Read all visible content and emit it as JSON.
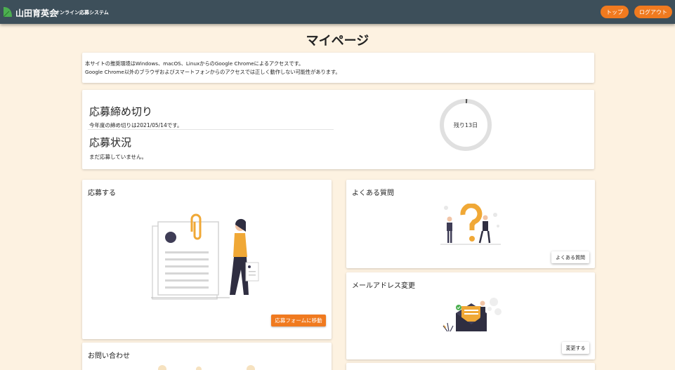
{
  "header": {
    "brand": "山田育英会",
    "subtitle": "オンライン応募システム",
    "nav": {
      "top": "トップ",
      "logout": "ログアウト"
    }
  },
  "page": {
    "title": "マイページ"
  },
  "notice": {
    "line1": "本サイトの推奨環境はWindows、macOS、LinuxからのGoogle Chromeによるアクセスです。",
    "line2": "Google Chrome以外のブラウザおよびスマートフォンからのアクセスでは正しく動作しない可能性があります。"
  },
  "status": {
    "deadline_heading": "応募締め切り",
    "deadline_text": "今年度の締め切りは2021/05/14です。",
    "application_heading": "応募状況",
    "application_text": "まだ応募していません。",
    "remaining_label": "残り13日",
    "remaining_progress": 0.01
  },
  "cards": {
    "apply": {
      "title": "応募する",
      "button": "応募フォームに移動"
    },
    "faq": {
      "title": "よくある質問",
      "button": "よくある質問"
    },
    "mail": {
      "title": "メールアドレス変更",
      "button": "変更する"
    },
    "contact": {
      "title": "お問い合わせ"
    }
  },
  "colors": {
    "appbar": "#3d4f5a",
    "accent": "#f07a1f",
    "background": "#fdf2e1",
    "illustration": "#f0a836"
  }
}
